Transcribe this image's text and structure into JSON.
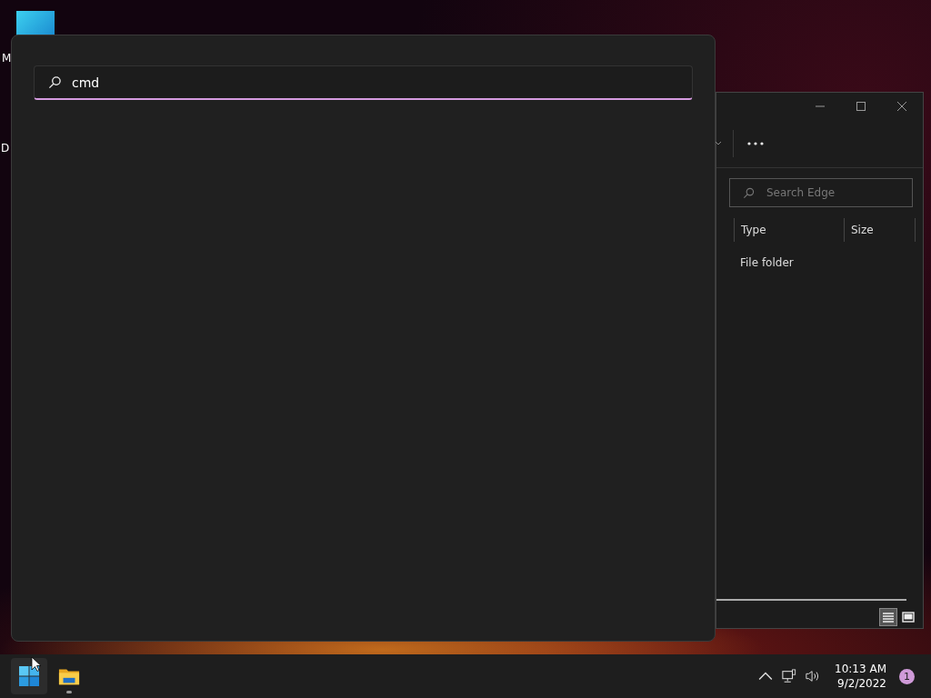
{
  "desktop": {
    "icons": [
      {
        "label": "M"
      },
      {
        "label": "D"
      }
    ]
  },
  "search_panel": {
    "query": "cmd"
  },
  "explorer": {
    "search": {
      "placeholder": "Search Edge"
    },
    "columns": [
      "Type",
      "Size"
    ],
    "rows": [
      {
        "type": "File folder"
      }
    ],
    "views": [
      {
        "kind": "details",
        "selected": true
      },
      {
        "kind": "tiles",
        "selected": false
      }
    ]
  },
  "taskbar": {
    "apps": [
      {
        "kind": "start",
        "running": false
      },
      {
        "kind": "folder",
        "running": true
      }
    ],
    "time": "10:13 AM",
    "date": "9/2/2022",
    "notifications": "1"
  }
}
